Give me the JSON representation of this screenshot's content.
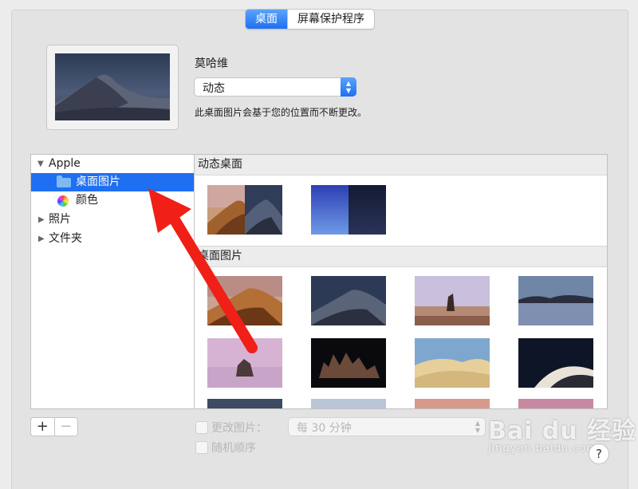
{
  "tabs": [
    {
      "label": "桌面",
      "active": true
    },
    {
      "label": "屏幕保护程序",
      "active": false
    }
  ],
  "wallpaper": {
    "name": "莫哈维",
    "mode": "动态",
    "description": "此桌面图片会基于您的位置而不断更改。"
  },
  "sidebar": {
    "items": [
      {
        "label": "Apple",
        "expanded": true,
        "icon": "disclosure-down-icon"
      },
      {
        "label": "桌面图片",
        "selected": true,
        "icon": "folder-icon"
      },
      {
        "label": "颜色",
        "icon": "color-wheel-icon"
      },
      {
        "label": "照片",
        "expanded": false,
        "icon": "disclosure-right-icon"
      },
      {
        "label": "文件夹",
        "expanded": false,
        "icon": "disclosure-right-icon"
      }
    ]
  },
  "sections": [
    {
      "title": "动态桌面",
      "thumbnails": [
        "mojave-dynamic",
        "solar-gradient"
      ]
    },
    {
      "title": "桌面图片",
      "thumbnails": [
        "mojave-day",
        "mojave-night",
        "mojave-rock",
        "dusk-lake",
        "mono-lake",
        "tufa-night",
        "sand-dunes",
        "dunes-night",
        "partial-1",
        "partial-2",
        "partial-3",
        "partial-4"
      ]
    }
  ],
  "bottom": {
    "add_label": "+",
    "remove_label": "−",
    "change_picture_label": "更改图片：",
    "interval_value": "每 30 分钟",
    "random_label": "随机顺序",
    "help_label": "?"
  },
  "watermark": {
    "brand": "Bai du 经验",
    "url": "jingyan.baidu.com"
  },
  "colors": {
    "accent": "#1f6ff2",
    "arrow": "#f01f17"
  }
}
